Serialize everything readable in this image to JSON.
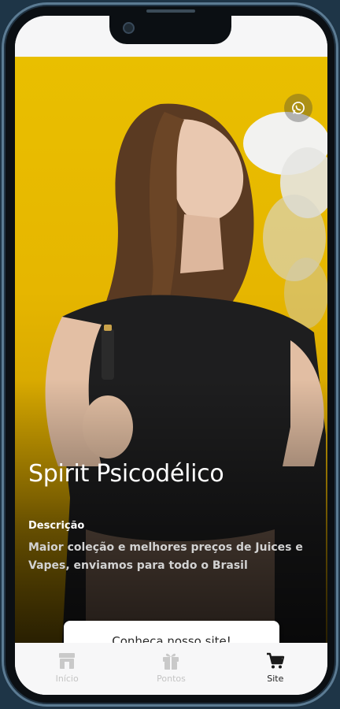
{
  "hero": {
    "title": "Spirit Psicodélico",
    "description_label": "Descrição",
    "description_text": "Maior coleção e melhores preços de Juices e Vapes, enviamos para todo o Brasil",
    "cta_label": "Conheça nosso site!",
    "background_color": "#E8BA00"
  },
  "tabbar": {
    "items": [
      {
        "label": "Início",
        "icon": "store-icon",
        "active": false
      },
      {
        "label": "Pontos",
        "icon": "gift-icon",
        "active": false
      },
      {
        "label": "Site",
        "icon": "cart-icon",
        "active": true
      }
    ]
  },
  "floating": {
    "icon": "whatsapp-icon"
  }
}
